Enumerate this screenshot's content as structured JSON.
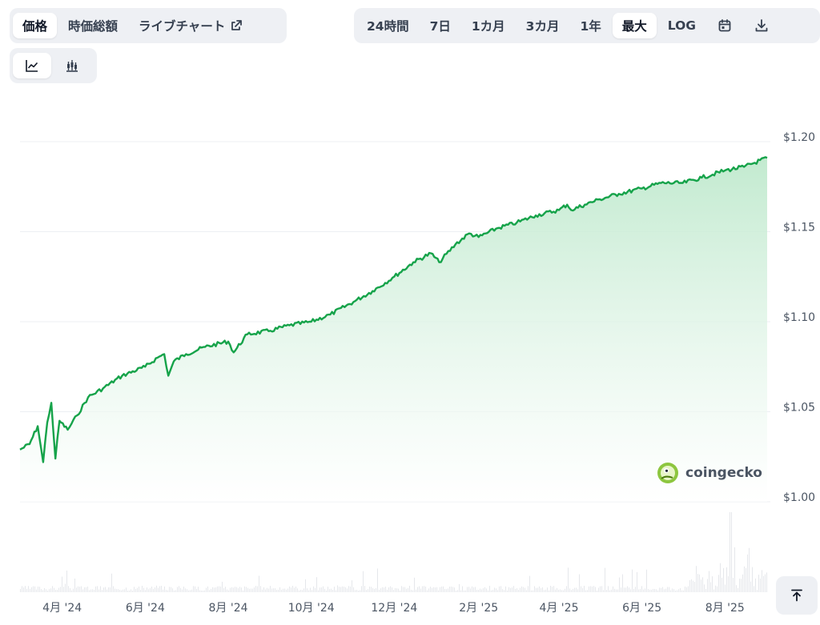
{
  "tabs": {
    "type": [
      {
        "label": "価格",
        "active": true
      },
      {
        "label": "時価総額",
        "active": false
      },
      {
        "label": "ライブチャート",
        "active": false,
        "icon": "external-link-icon"
      }
    ],
    "range": [
      {
        "label": "24時間",
        "active": false
      },
      {
        "label": "7日",
        "active": false
      },
      {
        "label": "1カ月",
        "active": false
      },
      {
        "label": "3カ月",
        "active": false
      },
      {
        "label": "1年",
        "active": false
      },
      {
        "label": "最大",
        "active": true
      },
      {
        "label": "LOG",
        "active": false
      }
    ],
    "range_icons": [
      "calendar-icon",
      "download-icon"
    ],
    "view": [
      "line-chart-icon",
      "candlestick-icon"
    ]
  },
  "watermark": {
    "text": "coingecko",
    "icon": "gecko-logo-icon"
  },
  "colors": {
    "line": "#16a34a",
    "area_top": "#bfe9cd",
    "grid": "#eceff3",
    "volume": "#e5e7eb"
  },
  "chart_data": {
    "type": "area",
    "x_labels": [
      "4月 '24",
      "6月 '24",
      "8月 '24",
      "10月 '24",
      "12月 '24",
      "2月 '25",
      "4月 '25",
      "6月 '25",
      "8月 '25"
    ],
    "y_ticks": [
      "$1.20",
      "$1.15",
      "$1.10",
      "$1.05",
      "$1.00"
    ],
    "ylim": [
      1.0,
      1.2
    ],
    "grid": true,
    "series": [
      {
        "points": [
          [
            "2024-03-01",
            1.029
          ],
          [
            "2024-03-08",
            1.032
          ],
          [
            "2024-03-14",
            1.042
          ],
          [
            "2024-03-18",
            1.022
          ],
          [
            "2024-03-21",
            1.044
          ],
          [
            "2024-03-24",
            1.055
          ],
          [
            "2024-03-27",
            1.024
          ],
          [
            "2024-03-30",
            1.045
          ],
          [
            "2024-04-05",
            1.04
          ],
          [
            "2024-04-12",
            1.048
          ],
          [
            "2024-04-20",
            1.058
          ],
          [
            "2024-05-01",
            1.063
          ],
          [
            "2024-05-15",
            1.07
          ],
          [
            "2024-06-01",
            1.075
          ],
          [
            "2024-06-10",
            1.08
          ],
          [
            "2024-06-15",
            1.082
          ],
          [
            "2024-06-18",
            1.07
          ],
          [
            "2024-06-22",
            1.078
          ],
          [
            "2024-07-01",
            1.082
          ],
          [
            "2024-07-15",
            1.086
          ],
          [
            "2024-08-01",
            1.089
          ],
          [
            "2024-08-05",
            1.083
          ],
          [
            "2024-08-15",
            1.093
          ],
          [
            "2024-09-01",
            1.095
          ],
          [
            "2024-09-15",
            1.098
          ],
          [
            "2024-10-01",
            1.1
          ],
          [
            "2024-10-15",
            1.104
          ],
          [
            "2024-11-01",
            1.111
          ],
          [
            "2024-11-15",
            1.117
          ],
          [
            "2024-12-01",
            1.125
          ],
          [
            "2024-12-15",
            1.133
          ],
          [
            "2024-12-28",
            1.138
          ],
          [
            "2025-01-03",
            1.133
          ],
          [
            "2025-01-15",
            1.143
          ],
          [
            "2025-01-25",
            1.149
          ],
          [
            "2025-02-01",
            1.147
          ],
          [
            "2025-02-15",
            1.152
          ],
          [
            "2025-03-01",
            1.155
          ],
          [
            "2025-03-15",
            1.159
          ],
          [
            "2025-04-01",
            1.162
          ],
          [
            "2025-04-07",
            1.165
          ],
          [
            "2025-04-10",
            1.162
          ],
          [
            "2025-04-20",
            1.165
          ],
          [
            "2025-05-01",
            1.168
          ],
          [
            "2025-05-15",
            1.171
          ],
          [
            "2025-06-01",
            1.174
          ],
          [
            "2025-06-15",
            1.177
          ],
          [
            "2025-07-01",
            1.177
          ],
          [
            "2025-07-15",
            1.18
          ],
          [
            "2025-08-01",
            1.184
          ],
          [
            "2025-08-15",
            1.186
          ],
          [
            "2025-09-01",
            1.191
          ]
        ]
      }
    ]
  }
}
